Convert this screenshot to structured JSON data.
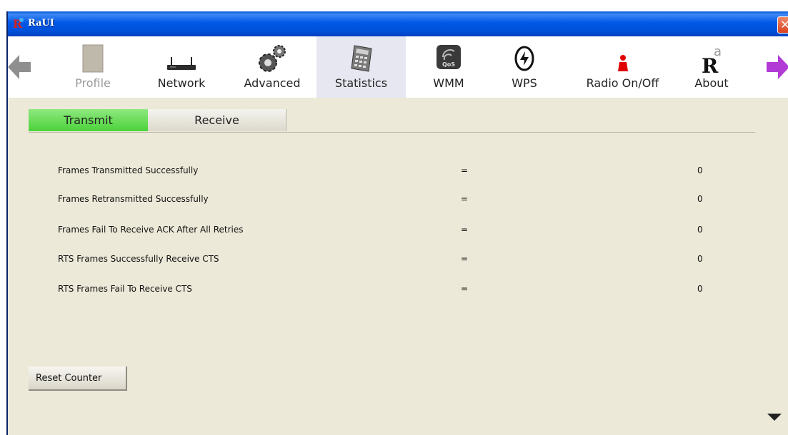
{
  "window": {
    "title": "RaUI",
    "close_glyph": "✕"
  },
  "toolbar": {
    "items": [
      {
        "label": "Profile",
        "icon": "profile-icon",
        "disabled": true
      },
      {
        "label": "Network",
        "icon": "network-icon"
      },
      {
        "label": "Advanced",
        "icon": "advanced-gears-icon"
      },
      {
        "label": "Statistics",
        "icon": "statistics-calculator-icon",
        "active": true
      },
      {
        "label": "WMM",
        "icon": "wmm-qos-icon"
      },
      {
        "label": "WPS",
        "icon": "wps-icon"
      },
      {
        "label": "Radio On/Off",
        "icon": "radio-onoff-icon"
      },
      {
        "label": "About",
        "icon": "about-icon"
      }
    ],
    "about_glyph": "R"
  },
  "tabs": {
    "transmit": "Transmit",
    "receive": "Receive",
    "active": "Transmit"
  },
  "stats": {
    "rows": [
      {
        "label": "Frames Transmitted Successfully",
        "eq": "=",
        "value": "0"
      },
      {
        "label": "Frames Retransmitted Successfully",
        "eq": "=",
        "value": "0"
      },
      {
        "label": "Frames Fail To Receive ACK After All Retries",
        "eq": "=",
        "value": "0"
      },
      {
        "label": "RTS Frames Successfully Receive CTS",
        "eq": "=",
        "value": "0"
      },
      {
        "label": "RTS Frames Fail To Receive CTS",
        "eq": "=",
        "value": "0"
      }
    ]
  },
  "actions": {
    "reset_label": "Reset Counter"
  },
  "colors": {
    "active_tab": "#4cd23a",
    "titlebar": "#0058e6",
    "panel": "#ece9d8"
  }
}
